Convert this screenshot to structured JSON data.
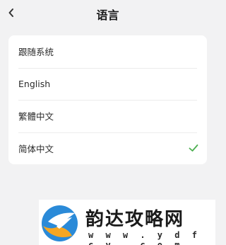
{
  "header": {
    "back_icon": "chevron-left-icon",
    "title": "语言"
  },
  "languages": [
    {
      "label": "跟随系统",
      "selected": false
    },
    {
      "label": "English",
      "selected": false
    },
    {
      "label": "繁體中文",
      "selected": false
    },
    {
      "label": "简体中文",
      "selected": true
    }
  ],
  "check_icon": "checkmark-icon",
  "accent_color": "#4caf50",
  "watermark": {
    "name": "韵达攻略网",
    "url": "w w w . y d f c y . c o m"
  }
}
